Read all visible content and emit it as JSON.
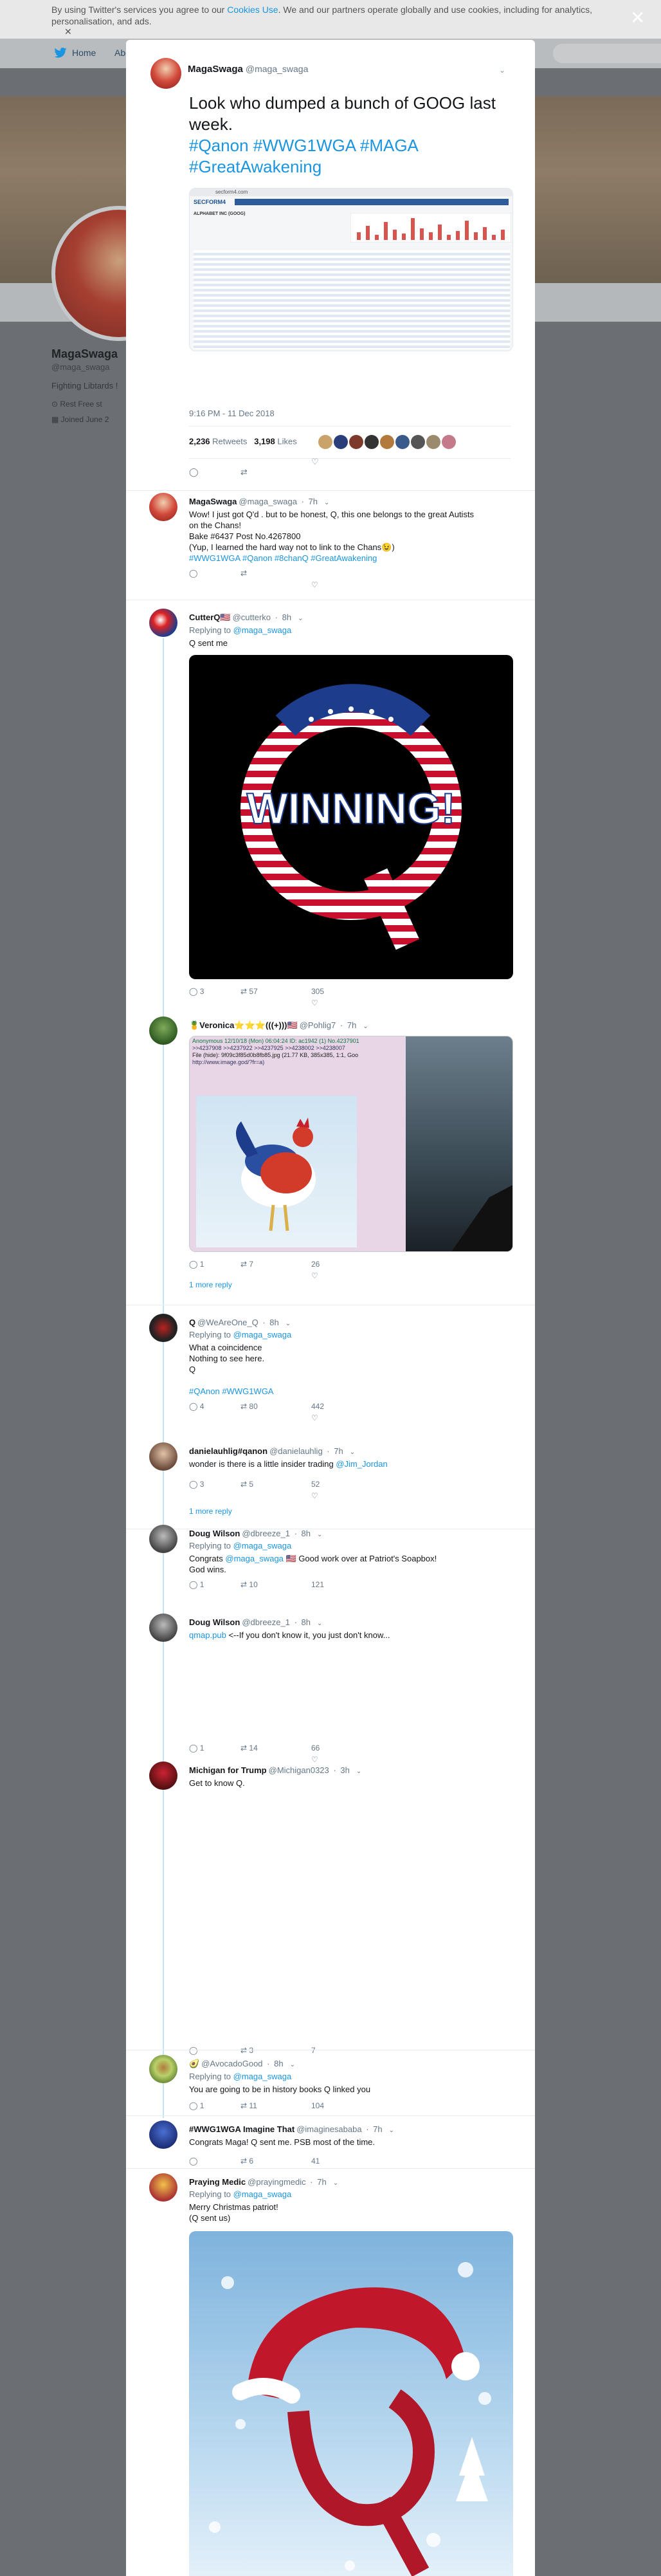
{
  "cookie_bar": {
    "line1_pre": "By using Twitter's services you agree to our ",
    "cookies_link": "Cookies Use",
    "line1_post": ". We and our partners operate globally and use cookies, including for analytics,",
    "line2": "personalisation, and ads.",
    "dismiss": "✕"
  },
  "bg_nav": {
    "home": "Home",
    "about": "Abo",
    "lang": "h ▾"
  },
  "bg_profile": {
    "name": "MagaSwaga",
    "handle": "@maga_swaga",
    "bio": "Fighting Libtards !",
    "location": "Rest Free st",
    "joined": "Joined June 2"
  },
  "close_label": "✕",
  "main_tweet": {
    "name": "MagaSwaga",
    "handle": "@maga_swaga",
    "text_plain": "Look who dumped a bunch of GOOG last week.",
    "hashtags": "#Qanon #WWG1WGA #MAGA #GreatAwakening",
    "timestamp": "9:16 PM - 11 Dec 2018",
    "retweets": "2,236",
    "retweets_label": "Retweets",
    "likes": "3,198",
    "likes_label": "Likes",
    "image": {
      "url": "secform4.com",
      "site_title": "SECFORM4",
      "nav": [
        "Insider Sells",
        "Insider Buys",
        "Latest Filings",
        "Latest Filings",
        "Institutional",
        "Hot Stock",
        "Hot Insider",
        "Insider Screener"
      ],
      "title_line": "ALPHABET INC (GOOG)"
    }
  },
  "replies": [
    {
      "name": "MagaSwaga",
      "handle": "@maga_swaga",
      "time": "7h",
      "lines": [
        "Wow!  I just got Q'd .   but to be honest, Q, this one belongs to the great Autists",
        "on the Chans!",
        "Bake #6437 Post No.4267800",
        "(Yup, I learned the hard way not to link to the Chans😉)"
      ],
      "tags": "#WWG1WGA #Qanon #8chanQ #GreatAwakening",
      "reply_count": "",
      "rt_count": "",
      "like_count": ""
    },
    {
      "name": "CutterQ🇺🇸",
      "handle": "@cutterko",
      "time": "8h",
      "replying_pre": "Replying to ",
      "replying_to": "@maga_swaga",
      "lines": [
        "Q sent me"
      ],
      "image_text": "WINNING!",
      "reply_count": "3",
      "rt_count": "57",
      "like_count": "305"
    },
    {
      "name": "🍍Veronica⭐⭐⭐(((+)))🇺🇸",
      "handle": "@Pohlig7",
      "time": "7h",
      "post_header": "Anonymous  12/10/18 (Mon) 06:04:24  ID: ac1942 (1)  No.4237901",
      "post_refs": ">>4237908 >>4237922 >>4237925 >>4238002 >>4238007",
      "post_file": "File (hide): 9f09c3f85d0b8fb85.jpg (21.77 KB, 385x385, 1:1, Goo",
      "post_link": "http://www.image.god/?fr=a)",
      "reply_count": "1",
      "rt_count": "7",
      "like_count": "26",
      "more": "1 more reply"
    },
    {
      "name": "Q",
      "handle": "@WeAreOne_Q",
      "time": "8h",
      "replying_pre": "Replying to ",
      "replying_to": "@maga_swaga",
      "lines": [
        "What a coincidence",
        "Nothing to see here.",
        "Q",
        "",
        "#QAnon #WWG1WGA"
      ],
      "reply_count": "4",
      "rt_count": "80",
      "like_count": "442"
    },
    {
      "name": "danielauhlig#qanon",
      "handle": "@danielauhlig",
      "time": "7h",
      "lines_pre": "wonder is there is a little insider trading ",
      "mention": "@Jim_Jordan",
      "reply_count": "3",
      "rt_count": "5",
      "like_count": "52",
      "more": "1 more reply"
    },
    {
      "name": "Doug Wilson",
      "handle": "@dbreeze_1",
      "time": "8h",
      "replying_pre": "Replying to ",
      "replying_to": "@maga_swaga",
      "line1_pre": "Congrats ",
      "line1_mention": "@maga_swaga",
      "line1_post": " 🇺🇸 Good work over at Patriot's Soapbox!",
      "line2": "God wins.",
      "reply_count": "1",
      "rt_count": "10",
      "like_count": "121"
    },
    {
      "name": "Doug Wilson",
      "handle": "@dbreeze_1",
      "time": "8h",
      "link": "qmap.pub",
      "text": " <--If you don't know it, you just don't know...",
      "reply_count": "1",
      "rt_count": "14",
      "like_count": "66"
    },
    {
      "name": "Michigan for Trump",
      "handle": "@Michigan0323",
      "time": "3h",
      "lines": [
        "Get to know Q."
      ],
      "reply_count": "",
      "rt_count": "3",
      "like_count": "7"
    },
    {
      "name": "🥑",
      "handle": "@AvocadoGood",
      "time": "8h",
      "replying_pre": "Replying to ",
      "replying_to": "@maga_swaga",
      "lines": [
        "You are going to be in history books Q linked you"
      ],
      "reply_count": "1",
      "rt_count": "11",
      "like_count": "104"
    },
    {
      "name": "#WWG1WGA Imagine That",
      "handle": "@imaginesababa",
      "time": "7h",
      "lines": [
        "Congrats Maga!  Q sent me. PSB most of the time."
      ],
      "reply_count": "",
      "rt_count": "6",
      "like_count": "41"
    },
    {
      "name": "Praying Medic",
      "handle": "@prayingmedic",
      "time": "7h",
      "replying_pre": "Replying to ",
      "replying_to": "@maga_swaga",
      "lines": [
        "Merry Christmas patriot!",
        "(Q sent us)"
      ]
    }
  ]
}
